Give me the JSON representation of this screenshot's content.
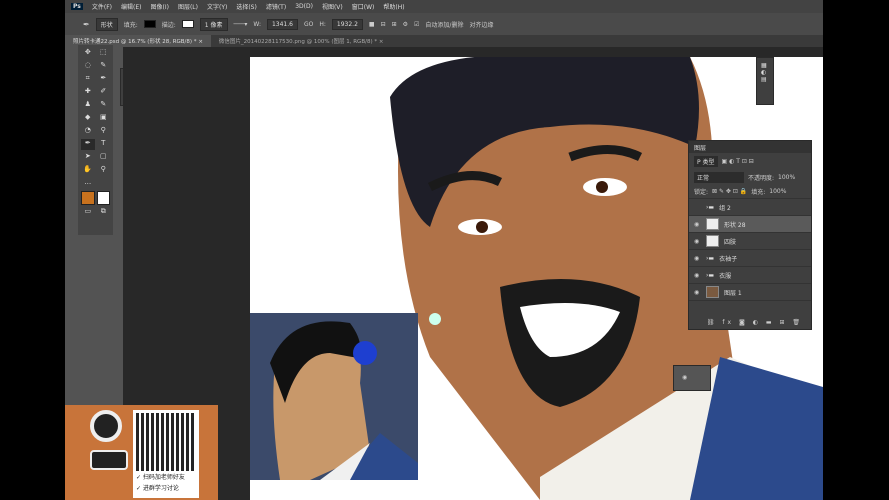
{
  "app": {
    "logo": "Ps"
  },
  "menu": [
    "文件(F)",
    "编辑(E)",
    "图像(I)",
    "图层(L)",
    "文字(Y)",
    "选择(S)",
    "滤镜(T)",
    "3D(D)",
    "视图(V)",
    "窗口(W)",
    "帮助(H)"
  ],
  "options": {
    "mode": "形状",
    "fill_label": "填充:",
    "stroke_label": "描边:",
    "stroke_width": "1 像素",
    "w_label": "W:",
    "w_value": "1341.6",
    "link": "GO",
    "h_label": "H:",
    "h_value": "1932.2",
    "auto_add": "自动添加/删除",
    "align_edges": "对齐边缘",
    "fill_color": "#000000"
  },
  "tabs": [
    {
      "label": "照片转卡通22.psd @ 16.7% (形状 28, RGB/8) *"
    },
    {
      "label": "微信图片_20140228117530.png @ 100% (图层 1, RGB/8) *"
    }
  ],
  "tools": [
    "✥",
    "⬚",
    "◌",
    "✎",
    "⌗",
    "✒",
    "✚",
    "✐",
    "♟",
    "✎",
    "◆",
    "▣",
    "◔",
    "⚲",
    "✒",
    "T",
    "➤",
    "▢",
    "✋",
    "⚲",
    "…",
    ""
  ],
  "paths_panel": {
    "items": [
      "⊢",
      "⇄"
    ]
  },
  "colors": {
    "foreground": "#c8721e",
    "background": "#ffffff",
    "skin": "#b07248",
    "suit": "#2c4a8c"
  },
  "layers": {
    "title": "图层",
    "filter": "P 类型",
    "blend": "正常",
    "opacity_label": "不透明度:",
    "opacity": "100%",
    "lock_label": "锁定:",
    "fill_label": "填充:",
    "fill": "100%",
    "items": [
      {
        "name": "组 2",
        "type": "group"
      },
      {
        "name": "形状 28",
        "type": "shape",
        "selected": true
      },
      {
        "name": "四肢",
        "type": "shape"
      },
      {
        "name": "衣袖子",
        "type": "group"
      },
      {
        "name": "衣服",
        "type": "group"
      },
      {
        "name": "图层 1",
        "type": "image"
      }
    ]
  },
  "ad": {
    "line1": "✓ 扫码加老师好友",
    "line2": "✓ 进群学习讨论"
  }
}
